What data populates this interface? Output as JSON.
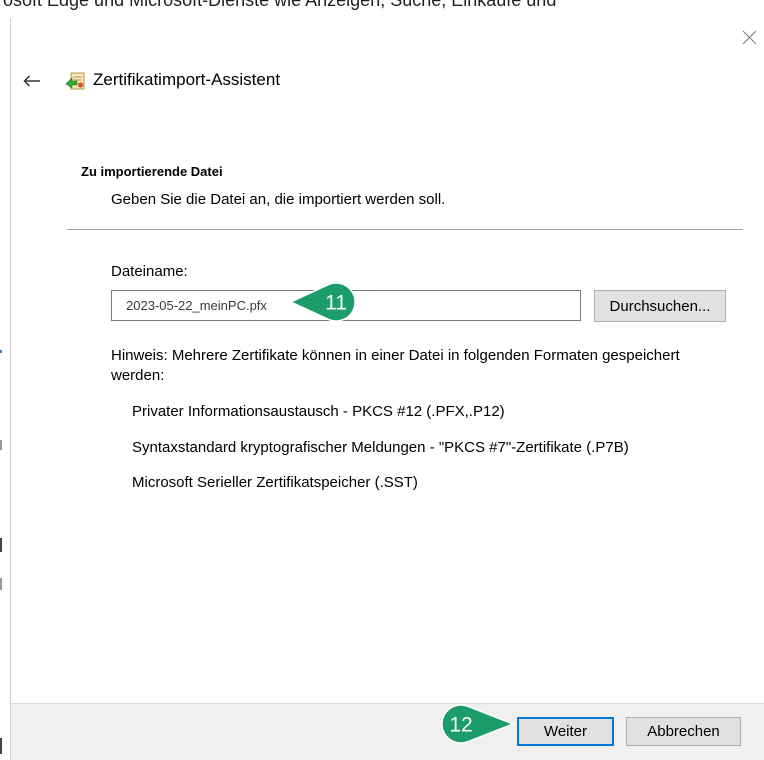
{
  "background": {
    "cut_text": "rosoft Edge und Microsoft-Dienste wie Anzeigen, Suche, Einkäufe und"
  },
  "dialog": {
    "title": "Zertifikatimport-Assistent",
    "icons": {
      "close": "close-icon",
      "back": "back-arrow-icon",
      "app": "certificate-import-icon"
    },
    "section_heading": "Zu importierende Datei",
    "section_description": "Geben Sie die Datei an, die importiert werden soll.",
    "file_label": "Dateiname:",
    "file_value": "2023-05-22_meinPC.pfx",
    "browse_label": "Durchsuchen...",
    "hint": "Hinweis: Mehrere Zertifikate können in einer Datei in folgenden Formaten gespeichert werden:",
    "formats": [
      "Privater Informationsaustausch - PKCS #12 (.PFX,.P12)",
      "Syntaxstandard kryptografischer Meldungen - \"PKCS #7\"-Zertifikate (.P7B)",
      "Microsoft Serieller Zertifikatspeicher (.SST)"
    ],
    "next_label": "Weiter",
    "cancel_label": "Abbrechen"
  },
  "annotations": [
    {
      "label": "11"
    },
    {
      "label": "12"
    }
  ],
  "colors": {
    "badge": "#1b9c6a",
    "footer": "#f0f0f0",
    "default_button_border": "#0078d7"
  }
}
